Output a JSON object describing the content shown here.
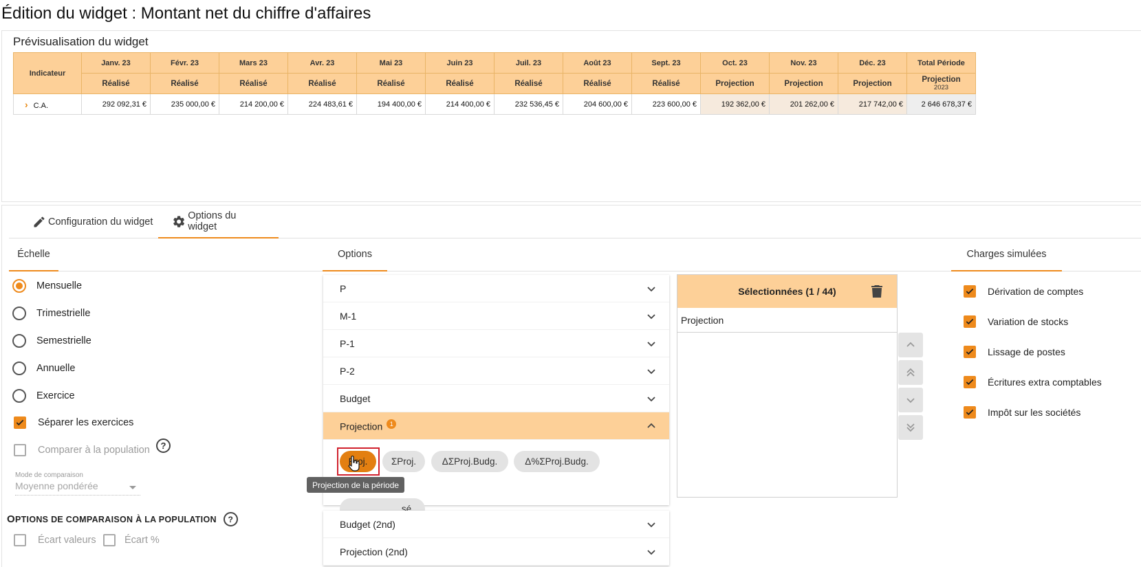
{
  "page": {
    "title": "Édition du widget : Montant net du chiffre d'affaires"
  },
  "preview": {
    "title": "Prévisualisation du widget",
    "indicator_header": "Indicateur",
    "months": [
      {
        "label": "Janv. 23",
        "type": "Réalisé",
        "value": "292 092,31 €"
      },
      {
        "label": "Févr. 23",
        "type": "Réalisé",
        "value": "235 000,00 €"
      },
      {
        "label": "Mars 23",
        "type": "Réalisé",
        "value": "214 200,00 €"
      },
      {
        "label": "Avr. 23",
        "type": "Réalisé",
        "value": "224 483,61 €"
      },
      {
        "label": "Mai 23",
        "type": "Réalisé",
        "value": "194 400,00 €"
      },
      {
        "label": "Juin 23",
        "type": "Réalisé",
        "value": "214 400,00 €"
      },
      {
        "label": "Juil. 23",
        "type": "Réalisé",
        "value": "232 536,45 €"
      },
      {
        "label": "Août 23",
        "type": "Réalisé",
        "value": "204 600,00 €"
      },
      {
        "label": "Sept. 23",
        "type": "Réalisé",
        "value": "223 600,00 €"
      },
      {
        "label": "Oct. 23",
        "type": "Projection",
        "value": "192 362,00 €"
      },
      {
        "label": "Nov. 23",
        "type": "Projection",
        "value": "201 262,00 €"
      },
      {
        "label": "Déc. 23",
        "type": "Projection",
        "value": "217 742,00 €"
      }
    ],
    "total": {
      "label": "Total Période",
      "type": "Projection",
      "year": "2023",
      "value": "2 646 678,37 €"
    },
    "row_label": "C.A."
  },
  "tabs": {
    "config": "Configuration du widget",
    "options": "Options du widget"
  },
  "subtabs": {
    "echelle": "Échelle",
    "options": "Options",
    "charges": "Charges simulées"
  },
  "echelle": {
    "radios": [
      {
        "label": "Mensuelle",
        "checked": true
      },
      {
        "label": "Trimestrielle",
        "checked": false
      },
      {
        "label": "Semestrielle",
        "checked": false
      },
      {
        "label": "Annuelle",
        "checked": false
      },
      {
        "label": "Exercice",
        "checked": false
      }
    ],
    "separer": "Séparer les exercices",
    "comparer": "Comparer à la population",
    "help": "?",
    "mode_label": "Mode de comparaison",
    "mode_value": "Moyenne pondérée",
    "heading_first": "O",
    "heading_rest": "PTIONS DE COMPARAISON À LA POPULATION",
    "ecart_valeurs": "Écart valeurs",
    "ecart_pct": "Écart %"
  },
  "options": {
    "accordion": [
      "P",
      "M-1",
      "P-1",
      "P-2",
      "Budget"
    ],
    "open_item": "Projection",
    "open_badge": "1",
    "chips": [
      "Proj.",
      "ΣProj.",
      "ΔΣProj.Budg.",
      "Δ%ΣProj.Budg.",
      "sé"
    ],
    "tooltip": "Projection de la période",
    "accordion_after": [
      "Budget (2nd)",
      "Projection (2nd)"
    ]
  },
  "selected": {
    "header": "Sélectionnées (1 / 44)",
    "items": [
      "Projection"
    ]
  },
  "charges": [
    "Dérivation de comptes",
    "Variation de stocks",
    "Lissage de postes",
    "Écritures extra comptables",
    "Impôt sur les sociétés"
  ],
  "colors": {
    "accent": "#ee8a1c",
    "header_bg": "#fdd098",
    "projection_cell": "#f6eadd",
    "tooltip_bg": "#616161"
  }
}
